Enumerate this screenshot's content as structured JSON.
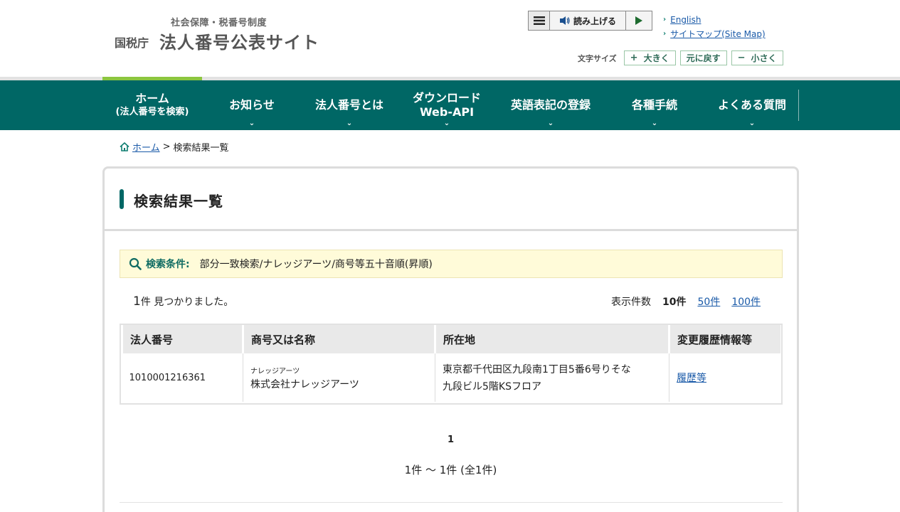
{
  "header": {
    "logo_sub": "社会保障・税番号制度",
    "logo_agency": "国税庁",
    "logo_main": "法人番号公表サイト",
    "read_aloud": "読み上げる",
    "links": [
      "English",
      "サイトマップ(Site Map)"
    ],
    "font_size_label": "文字サイズ",
    "font_larger": "大きく",
    "font_reset": "元に戻す",
    "font_smaller": "小さく"
  },
  "nav": {
    "items": [
      {
        "t1": "ホーム",
        "t2": "(法人番号を検索)"
      },
      {
        "t1": "お知らせ",
        "t2": ""
      },
      {
        "t1": "法人番号とは",
        "t2": ""
      },
      {
        "t1": "ダウンロード",
        "t2": "Web-API"
      },
      {
        "t1": "英語表記の登録",
        "t2": ""
      },
      {
        "t1": "各種手続",
        "t2": ""
      },
      {
        "t1": "よくある質問",
        "t2": ""
      }
    ]
  },
  "breadcrumb": {
    "home": "ホーム",
    "sep": ">",
    "current": "検索結果一覧"
  },
  "main": {
    "title": "検索結果一覧",
    "condition_label": "検索条件:",
    "condition_value": "部分一致検索/ナレッジアーツ/商号等五十音順(昇順)",
    "count_num": "1",
    "count_text": "件 見つかりました。",
    "per_page_label": "表示件数",
    "per_page_current": "10件",
    "per_page_options": [
      "50件",
      "100件"
    ],
    "table": {
      "headers": [
        "法人番号",
        "商号又は名称",
        "所在地",
        "変更履歴情報等"
      ],
      "rows": [
        {
          "number": "1010001216361",
          "kana": "ナレッジアーツ",
          "name": "株式会社ナレッジアーツ",
          "address_line1": "東京都千代田区九段南1丁目5番6号りそな",
          "address_line2": "九段ビル5階KSフロア",
          "history": "履歴等"
        }
      ]
    },
    "pager_current": "1",
    "range_text": "1件 ～ 1件 (全1件)"
  }
}
